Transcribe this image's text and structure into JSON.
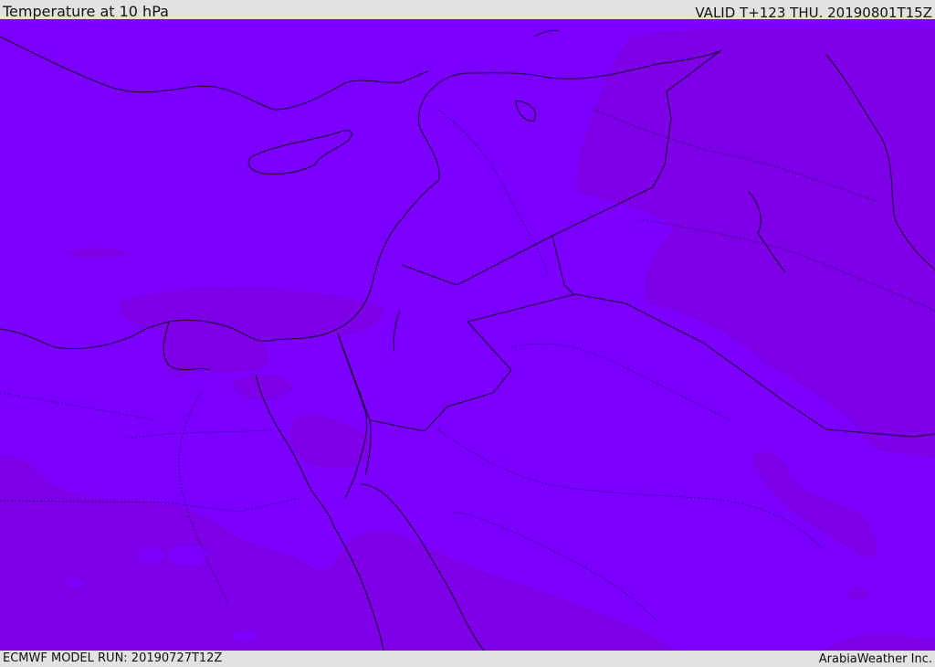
{
  "header": {
    "title": "Temperature at 10 hPa",
    "valid": "VALID T+123 THU. 20190801T15Z"
  },
  "footer": {
    "model_run": "ECMWF MODEL RUN: 20190727T12Z",
    "credit": "ArabiaWeather Inc."
  },
  "colors": {
    "field_main": "#7b00ff",
    "field_warm": "#7d00e6",
    "field_blob": "#8200d6",
    "borders": "#1a0033",
    "bar_bg": "#e2e2e2"
  }
}
